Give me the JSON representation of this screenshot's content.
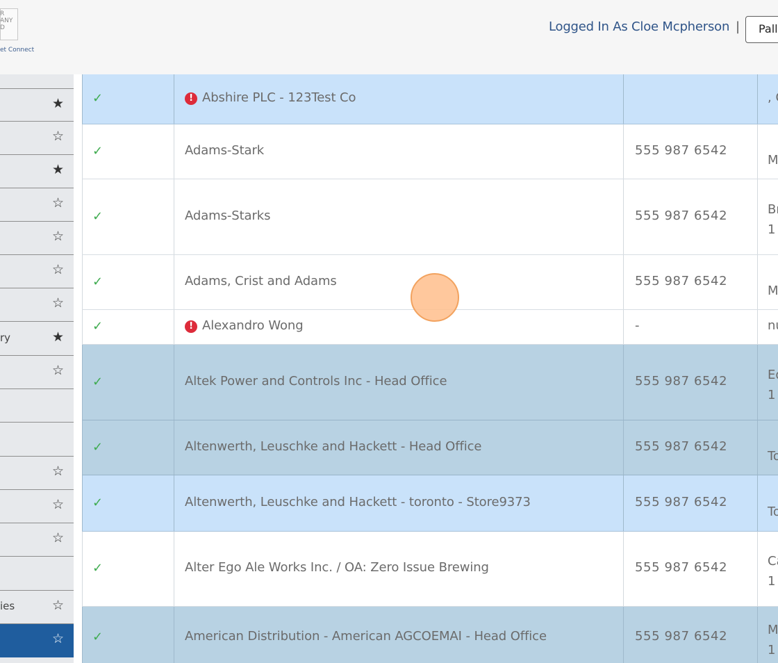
{
  "header": {
    "logo_letters": "R\nANY\nD",
    "logo_caption": "et Connect",
    "logged_in": "Logged In As Cloe Mcpherson",
    "separator": "|",
    "button_label": "Pallet"
  },
  "sidebar": {
    "items": [
      {
        "label": "",
        "starred": true,
        "star": "★"
      },
      {
        "label": "",
        "starred": false,
        "star": "☆"
      },
      {
        "label": "",
        "starred": true,
        "star": "★"
      },
      {
        "label": "",
        "starred": false,
        "star": "☆"
      },
      {
        "label": "",
        "starred": false,
        "star": "☆"
      },
      {
        "label": "",
        "starred": false,
        "star": "☆"
      },
      {
        "label": "",
        "starred": false,
        "star": "☆"
      },
      {
        "label": "ry",
        "starred": true,
        "star": "★"
      },
      {
        "label": "",
        "starred": false,
        "star": "☆"
      },
      {
        "label": "",
        "starred": null,
        "star": ""
      },
      {
        "label": "",
        "starred": null,
        "star": ""
      },
      {
        "label": "",
        "starred": false,
        "star": "☆"
      },
      {
        "label": "",
        "starred": false,
        "star": "☆"
      },
      {
        "label": "",
        "starred": false,
        "star": "☆"
      },
      {
        "label": "",
        "starred": null,
        "star": ""
      },
      {
        "label": "ies",
        "starred": false,
        "star": "☆"
      },
      {
        "label": "",
        "starred": false,
        "star": "☆",
        "active": true
      }
    ]
  },
  "table": {
    "check_glyph": "✓",
    "alert_glyph": "!",
    "rows": [
      {
        "name": "Abshire PLC - 123Test Co",
        "alert": true,
        "phone": "",
        "addr1": ", C",
        "addr2": "",
        "style": "light"
      },
      {
        "name": "Adams-Stark",
        "alert": false,
        "phone": "555 987 6542",
        "addr1": "",
        "addr2": "M",
        "style": "white"
      },
      {
        "name": "Adams-Starks",
        "alert": false,
        "phone": "555 987 6542",
        "addr1": "Br",
        "addr2": "1",
        "style": "white"
      },
      {
        "name": "Adams, Crist and Adams",
        "alert": false,
        "phone": "555 987 6542",
        "addr1": "",
        "addr2": "M",
        "style": "white"
      },
      {
        "name": "Alexandro Wong",
        "alert": true,
        "phone": "-",
        "addr1": "nu",
        "addr2": "",
        "style": "white"
      },
      {
        "name": "Altek Power and Controls Inc - Head Office",
        "alert": false,
        "phone": "555 987 6542",
        "addr1": "Ed",
        "addr2": "1",
        "style": "dark"
      },
      {
        "name": "Altenwerth, Leuschke and Hackett - Head Office",
        "alert": false,
        "phone": "555 987 6542",
        "addr1": "",
        "addr2": "To",
        "style": "dark"
      },
      {
        "name": "Altenwerth, Leuschke and Hackett - toronto - Store9373",
        "alert": false,
        "phone": "555 987 6542",
        "addr1": "",
        "addr2": "To",
        "style": "light"
      },
      {
        "name": "Alter Ego Ale Works Inc. / OA: Zero Issue Brewing",
        "alert": false,
        "phone": "555 987 6542",
        "addr1": "Ca",
        "addr2": "1",
        "style": "white"
      },
      {
        "name": "American Distribution - American AGCOEMAI - Head Office",
        "alert": false,
        "phone": "555 987 6542",
        "addr1": "M",
        "addr2": "1",
        "style": "dark"
      }
    ]
  }
}
